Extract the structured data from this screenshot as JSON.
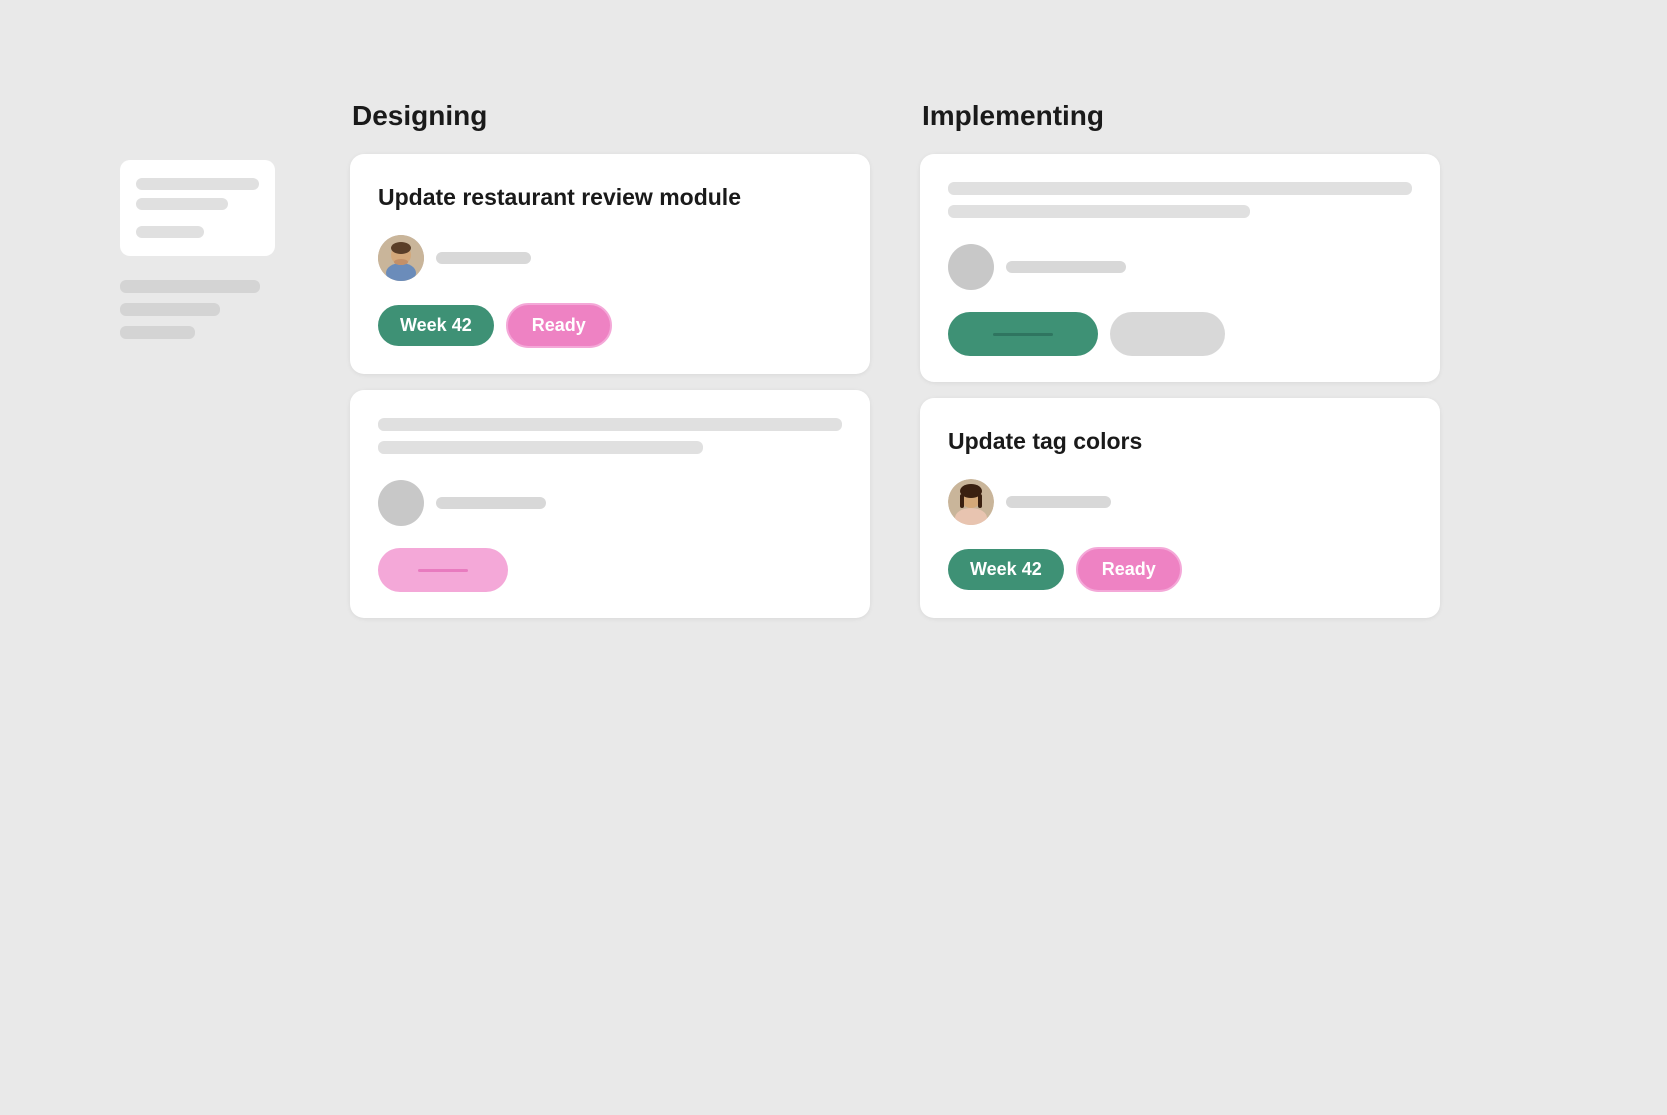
{
  "columns": {
    "designing": {
      "label": "Designing",
      "cards": [
        {
          "id": "card-1",
          "title": "Update restaurant review module",
          "has_avatar": true,
          "avatar_type": "man",
          "meta_text": "",
          "tags": [
            {
              "label": "Week 42",
              "type": "green"
            },
            {
              "label": "Ready",
              "type": "pink"
            }
          ]
        },
        {
          "id": "card-2",
          "title": "",
          "has_avatar": true,
          "avatar_type": "placeholder",
          "meta_text": "",
          "tags": [
            {
              "label": "",
              "type": "pink-ghost"
            }
          ]
        }
      ]
    },
    "implementing": {
      "label": "Implementing",
      "cards": [
        {
          "id": "card-3",
          "title": "",
          "has_avatar": true,
          "avatar_type": "placeholder",
          "meta_text": "",
          "tags": [
            {
              "label": "",
              "type": "green-ghost"
            },
            {
              "label": "",
              "type": "gray-ghost"
            }
          ]
        },
        {
          "id": "card-4",
          "title": "Update tag colors",
          "has_avatar": true,
          "avatar_type": "woman",
          "meta_text": "",
          "tags": [
            {
              "label": "Week 42",
              "type": "green"
            },
            {
              "label": "Ready",
              "type": "pink"
            }
          ]
        }
      ]
    }
  },
  "ghost_column": {
    "bars": [
      "long",
      "medium",
      "long",
      "short",
      "medium",
      "long",
      "short"
    ]
  }
}
